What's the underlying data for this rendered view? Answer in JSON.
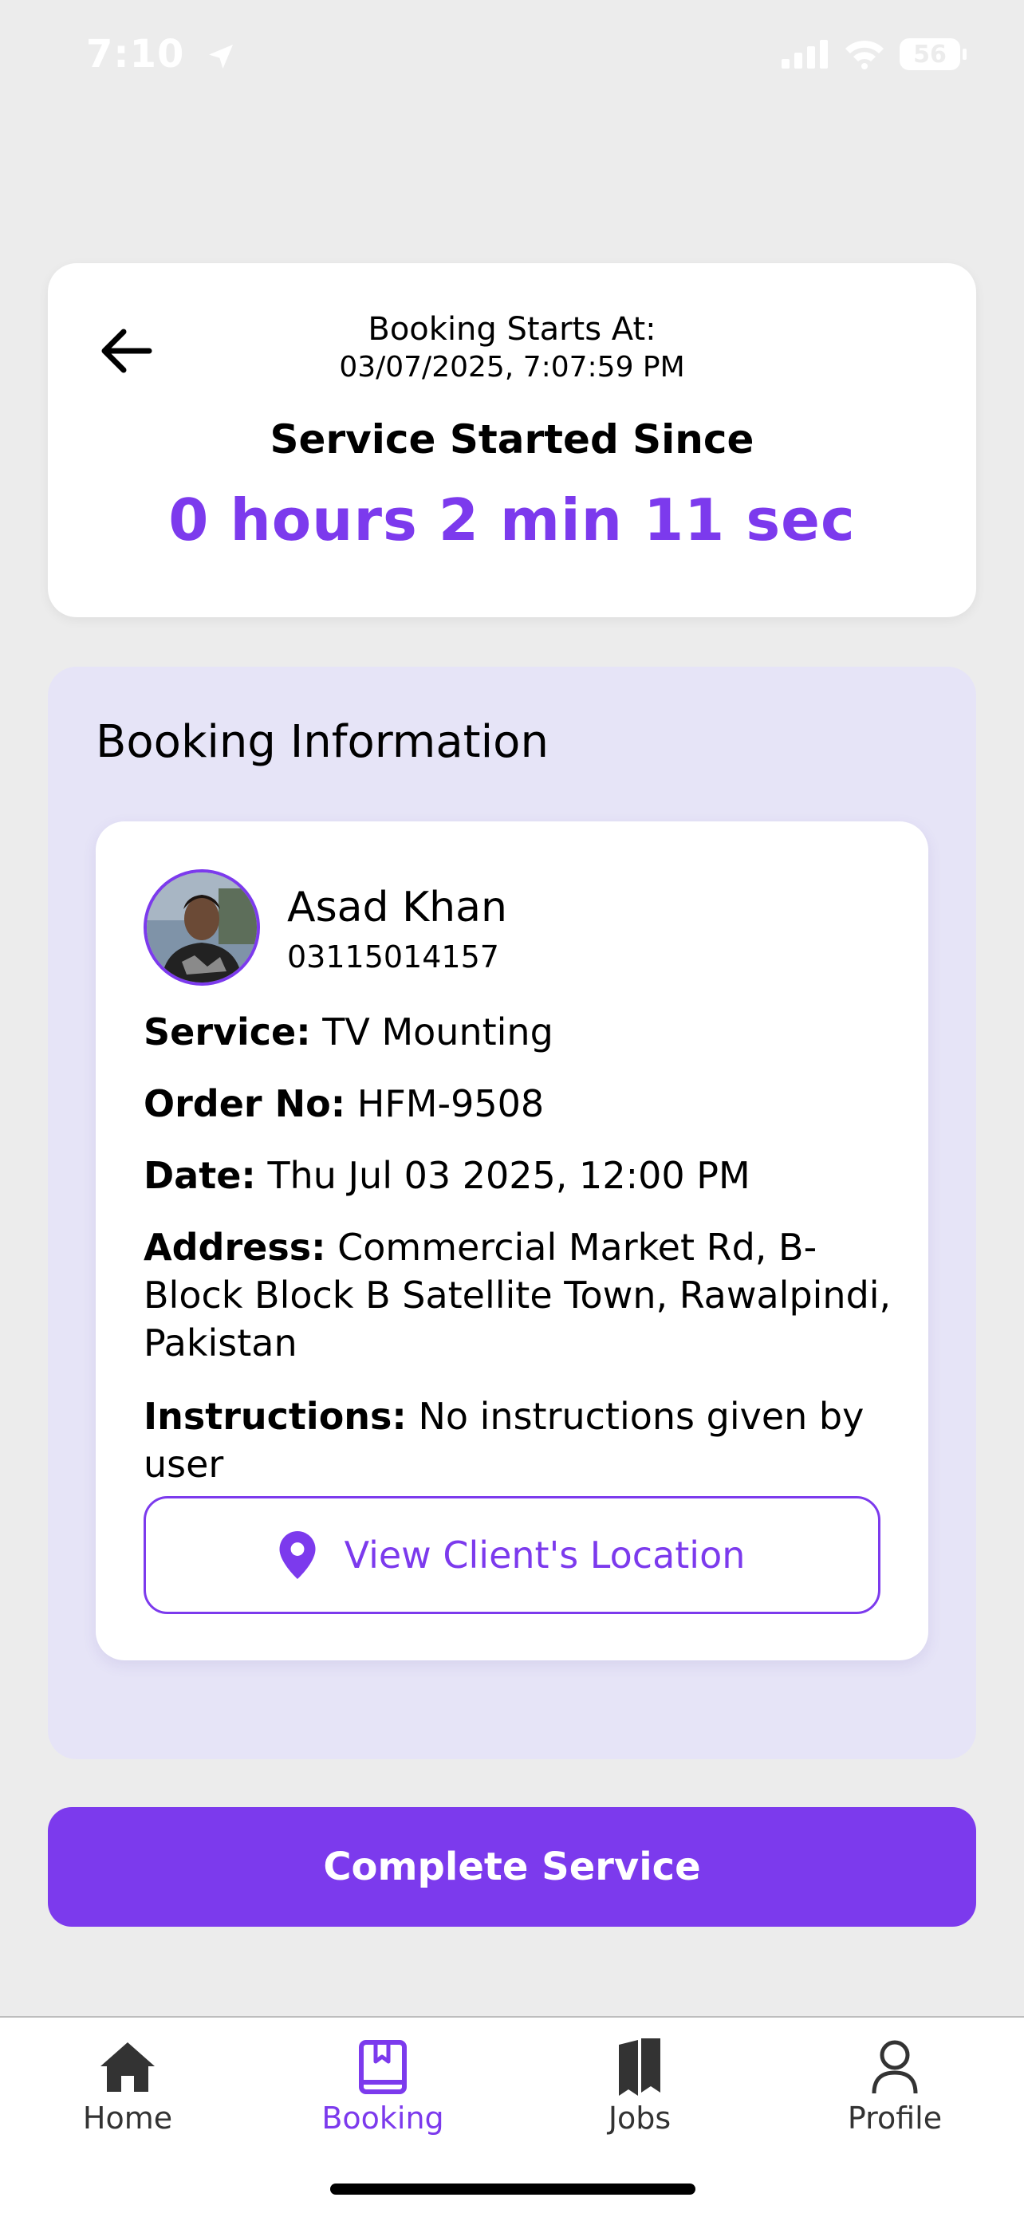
{
  "status": {
    "time": "7:10",
    "battery": "56"
  },
  "timer": {
    "starts_label": "Booking Starts At:",
    "starts_value": "03/07/2025, 7:07:59 PM",
    "since_label": "Service Started Since",
    "since_value": "0 hours 2 min 11 sec"
  },
  "booking_info": {
    "title": "Booking Information",
    "client": {
      "name": "Asad Khan",
      "phone": "03115014157"
    },
    "fields": [
      {
        "label": "Service:",
        "value": "TV Mounting"
      },
      {
        "label": "Order No:",
        "value": "HFM-9508"
      },
      {
        "label": "Date:",
        "value": "Thu Jul 03 2025, 12:00 PM"
      },
      {
        "label": "Address:",
        "value": "Commercial Market Rd, B-Block Block B Satellite Town, Rawalpindi, Pakistan"
      },
      {
        "label": "Instructions:",
        "value": "No instructions given by user"
      }
    ],
    "location_button": "View Client's Location"
  },
  "complete_button": "Complete Service",
  "tabs": [
    {
      "label": "Home",
      "icon": "home-icon"
    },
    {
      "label": "Booking",
      "icon": "booking-icon",
      "active": true
    },
    {
      "label": "Jobs",
      "icon": "jobs-icon"
    },
    {
      "label": "Profile",
      "icon": "profile-icon"
    }
  ],
  "colors": {
    "accent": "#7c3aed",
    "section_bg": "#e6e4f7",
    "page_bg": "#ececec"
  }
}
